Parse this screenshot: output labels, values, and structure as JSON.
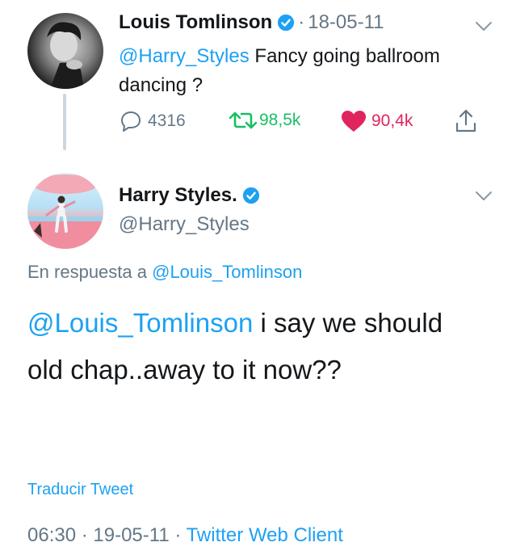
{
  "tweet1": {
    "author_name": "Louis Tomlinson",
    "separator": "·",
    "date": "18-05-11",
    "mention": "@Harry_Styles",
    "text_after_mention": " Fancy going ballroom dancing ?",
    "reply_count": "4316",
    "retweet_count": "98,5k",
    "like_count": "90,4k",
    "icons": [
      "verified-icon",
      "chevron-down-icon",
      "reply-icon",
      "retweet-icon",
      "heart-icon",
      "share-icon"
    ]
  },
  "tweet2": {
    "author_name": "Harry Styles.",
    "handle": "@Harry_Styles",
    "reply_prefix": "En respuesta a ",
    "reply_to": "@Louis_Tomlinson",
    "mention": "@Louis_Tomlinson",
    "text_after_mention": " i say we should old chap..away to it now??",
    "translate_label": "Traducir Tweet",
    "time": "06:30",
    "meta_sep1": " · ",
    "date": "19-05-11",
    "meta_sep2": " · ",
    "client": "Twitter Web Client"
  },
  "colors": {
    "accent": "#1da1f2",
    "retweet": "#17bf63",
    "like": "#e0245e",
    "muted": "#657786",
    "text": "#14171a"
  }
}
